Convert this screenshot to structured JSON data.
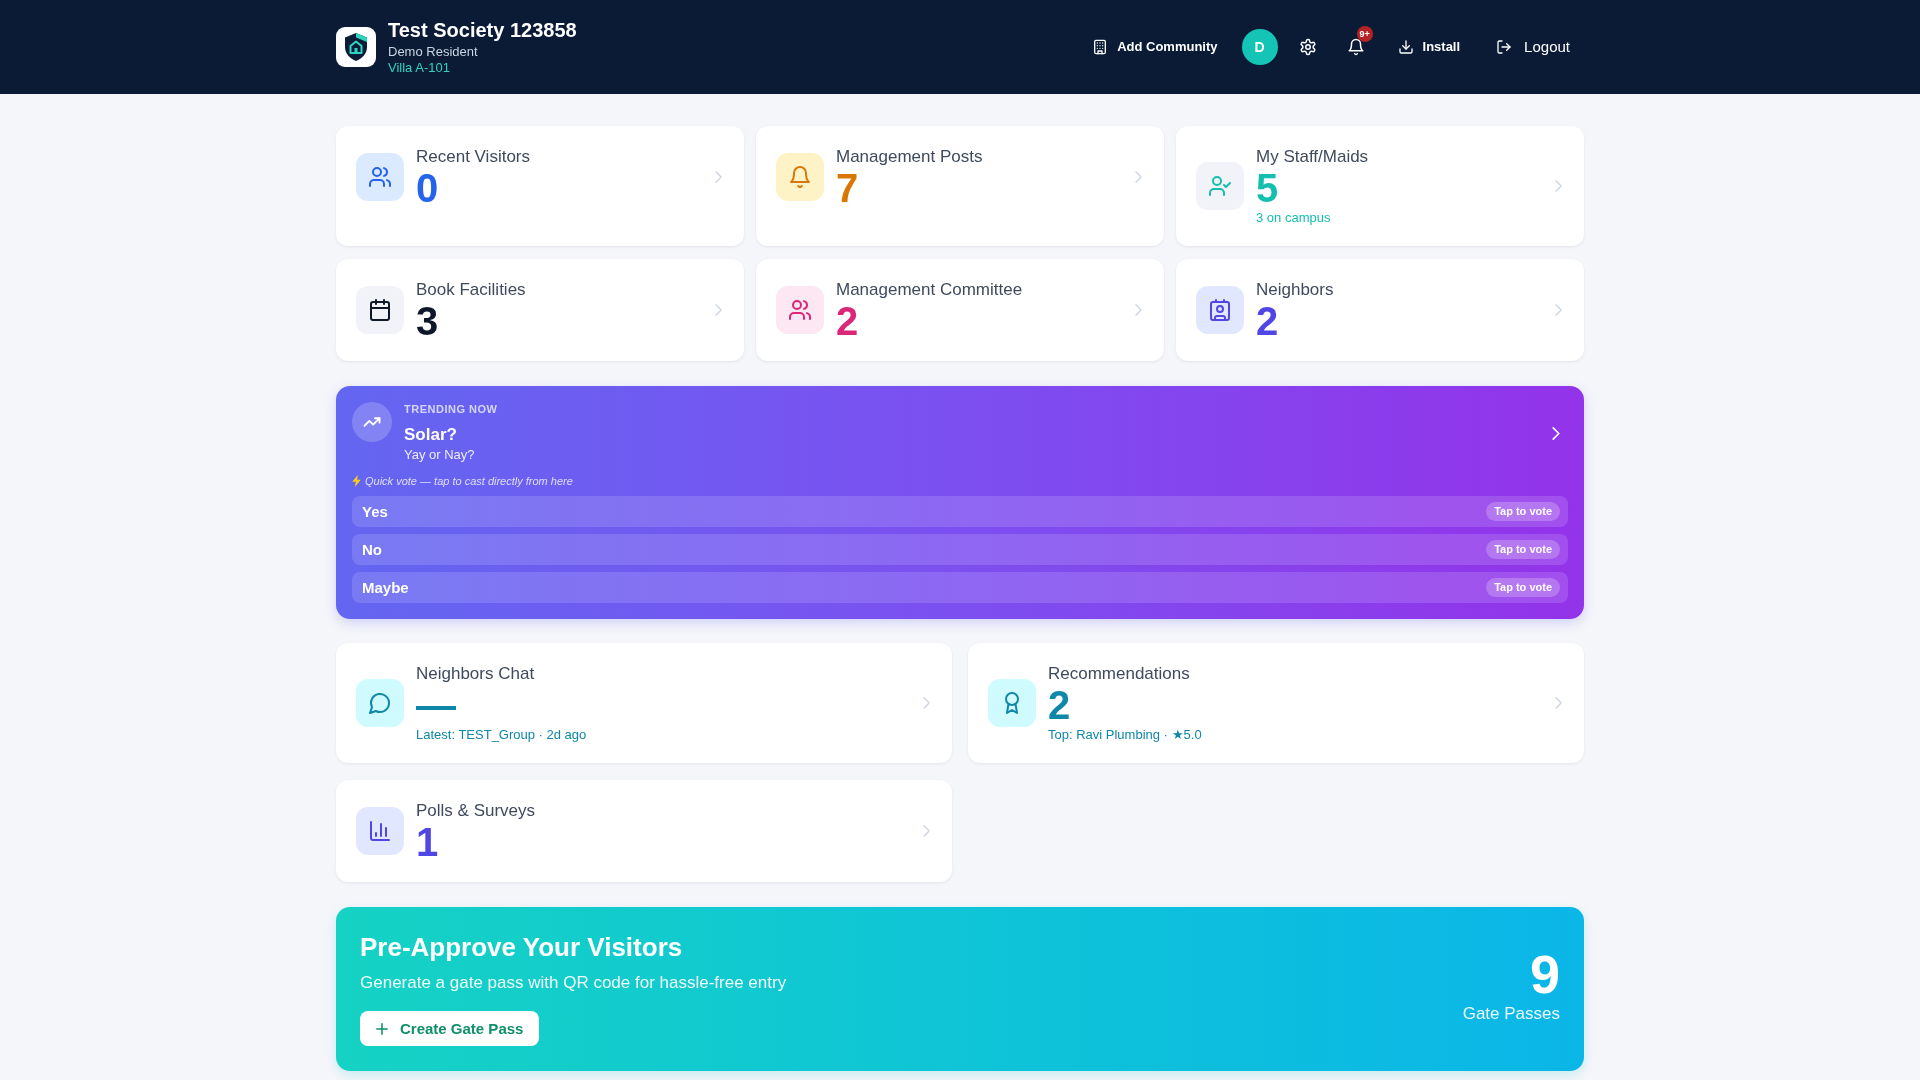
{
  "header": {
    "title": "Test Society 123858",
    "role": "Demo Resident",
    "unit": "Villa A-101",
    "add_community": "Add Community",
    "avatar": "D",
    "notification_badge": "9+",
    "install": "Install",
    "logout": "Logout"
  },
  "stat_cards": [
    {
      "title": "Recent Visitors",
      "value": "0",
      "color": "#2563eb"
    },
    {
      "title": "Management Posts",
      "value": "7",
      "color": "#d97706"
    },
    {
      "title": "My Staff/Maids",
      "value": "5",
      "subtext": "3 on campus",
      "color": "#13bfae"
    },
    {
      "title": "Book Facilities",
      "value": "3",
      "color": "#0f172a"
    },
    {
      "title": "Management Committee",
      "value": "2",
      "color": "#db2777"
    },
    {
      "title": "Neighbors",
      "value": "2",
      "color": "#4f46e5"
    }
  ],
  "trending": {
    "label": "TRENDING NOW",
    "question": "Solar?",
    "subtitle": "Yay or Nay?",
    "hint": "Quick vote — tap to cast directly from here",
    "options": [
      {
        "label": "Yes",
        "action": "Tap to vote"
      },
      {
        "label": "No",
        "action": "Tap to vote"
      },
      {
        "label": "Maybe",
        "action": "Tap to vote"
      }
    ]
  },
  "feature_cards": [
    {
      "title": "Neighbors Chat",
      "value": "—",
      "subtext": "Latest: TEST_Group · 2d ago",
      "color": "#0e87a8"
    },
    {
      "title": "Recommendations",
      "value": "2",
      "subtext": "Top: Ravi Plumbing · ★5.0",
      "color": "#0e87a8"
    },
    {
      "title": "Polls & Surveys",
      "value": "1",
      "color": "#4f46e5"
    }
  ],
  "gate_pass_banner": {
    "title": "Pre-Approve Your Visitors",
    "subtitle": "Generate a gate pass with QR code for hassle-free entry",
    "button": "Create Gate Pass",
    "count": "9",
    "count_label": "Gate Passes"
  }
}
